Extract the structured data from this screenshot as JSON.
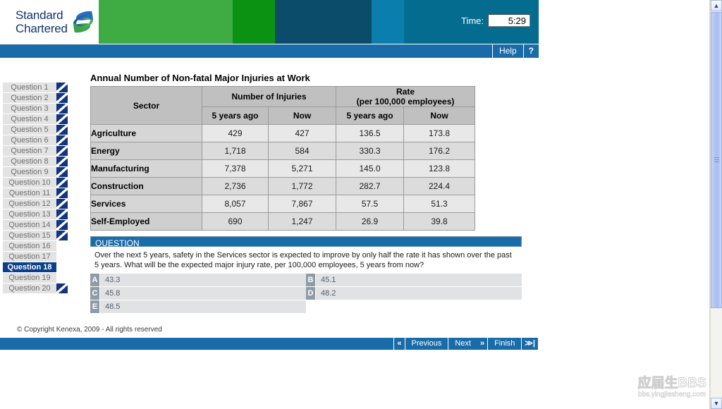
{
  "brand": {
    "line1": "Standard",
    "line2": "Chartered",
    "logo_icon": "standard-chartered-twist-logo"
  },
  "header": {
    "time_label": "Time:",
    "time_value": "5:29",
    "bands": [
      "#3eac43",
      "#0c9212",
      "#0b4c6b",
      "#0a7fae",
      "#046c8f"
    ]
  },
  "navbar": {
    "help_label": "Help",
    "question_mark_label": "?"
  },
  "sidebar": {
    "items": [
      {
        "label": "Question 1",
        "marked": true,
        "selected": false
      },
      {
        "label": "Question 2",
        "marked": true,
        "selected": false
      },
      {
        "label": "Question 3",
        "marked": true,
        "selected": false
      },
      {
        "label": "Question 4",
        "marked": true,
        "selected": false
      },
      {
        "label": "Question 5",
        "marked": true,
        "selected": false
      },
      {
        "label": "Question 6",
        "marked": true,
        "selected": false
      },
      {
        "label": "Question 7",
        "marked": true,
        "selected": false
      },
      {
        "label": "Question 8",
        "marked": true,
        "selected": false
      },
      {
        "label": "Question 9",
        "marked": true,
        "selected": false
      },
      {
        "label": "Question 10",
        "marked": true,
        "selected": false
      },
      {
        "label": "Question 11",
        "marked": true,
        "selected": false
      },
      {
        "label": "Question 12",
        "marked": true,
        "selected": false
      },
      {
        "label": "Question 13",
        "marked": true,
        "selected": false
      },
      {
        "label": "Question 14",
        "marked": true,
        "selected": false
      },
      {
        "label": "Question 15",
        "marked": true,
        "selected": false
      },
      {
        "label": "Question 16",
        "marked": false,
        "selected": false
      },
      {
        "label": "Question 17",
        "marked": false,
        "selected": false
      },
      {
        "label": "Question 18",
        "marked": false,
        "selected": true
      },
      {
        "label": "Question 19",
        "marked": false,
        "selected": false
      },
      {
        "label": "Question 20",
        "marked": true,
        "selected": false
      }
    ]
  },
  "main": {
    "table_title": "Annual Number of Non-fatal Major Injuries at Work",
    "table": {
      "group_headers": [
        {
          "label": "Sector"
        },
        {
          "label": "Number of Injuries"
        },
        {
          "label": "Rate\n(per 100,000 employees)",
          "line1": "Rate",
          "line2": "(per 100,000 employees)"
        }
      ],
      "sub_headers": [
        "5 years ago",
        "Now",
        "5 years ago",
        "Now"
      ],
      "rows": [
        {
          "sector": "Agriculture",
          "injuries_5y": "429",
          "injuries_now": "427",
          "rate_5y": "136.5",
          "rate_now": "173.8"
        },
        {
          "sector": "Energy",
          "injuries_5y": "1,718",
          "injuries_now": "584",
          "rate_5y": "330.3",
          "rate_now": "176.2"
        },
        {
          "sector": "Manufacturing",
          "injuries_5y": "7,378",
          "injuries_now": "5,271",
          "rate_5y": "145.0",
          "rate_now": "123.8"
        },
        {
          "sector": "Construction",
          "injuries_5y": "2,736",
          "injuries_now": "1,772",
          "rate_5y": "282.7",
          "rate_now": "224.4"
        },
        {
          "sector": "Services",
          "injuries_5y": "8,057",
          "injuries_now": "7,867",
          "rate_5y": "57.5",
          "rate_now": "51.3"
        },
        {
          "sector": "Self-Employed",
          "injuries_5y": "690",
          "injuries_now": "1,247",
          "rate_5y": "26.9",
          "rate_now": "39.8"
        }
      ]
    },
    "question": {
      "header": "QUESTION",
      "text": "Over the next 5 years, safety in the Services sector is expected to improve by only half the rate it has shown over the past 5 years. What will be the expected major injury rate, per 100,000 employees, 5 years from now?",
      "options": [
        {
          "letter": "A",
          "text": "43.3"
        },
        {
          "letter": "B",
          "text": "45.1"
        },
        {
          "letter": "C",
          "text": "45.8"
        },
        {
          "letter": "D",
          "text": "48.2"
        },
        {
          "letter": "E",
          "text": "48.5"
        }
      ]
    }
  },
  "chart_data": {
    "type": "table",
    "title": "Annual Number of Non-fatal Major Injuries at Work",
    "categories": [
      "Agriculture",
      "Energy",
      "Manufacturing",
      "Construction",
      "Services",
      "Self-Employed"
    ],
    "series": [
      {
        "name": "Number of Injuries - 5 years ago",
        "values": [
          429,
          1718,
          7378,
          2736,
          8057,
          690
        ]
      },
      {
        "name": "Number of Injuries - Now",
        "values": [
          427,
          584,
          5271,
          1772,
          7867,
          1247
        ]
      },
      {
        "name": "Rate (per 100,000 employees) - 5 years ago",
        "values": [
          136.5,
          330.3,
          145.0,
          282.7,
          57.5,
          26.9
        ]
      },
      {
        "name": "Rate (per 100,000 employees) - Now",
        "values": [
          173.8,
          176.2,
          123.8,
          224.4,
          51.3,
          39.8
        ]
      }
    ],
    "xlabel": "Sector",
    "ylabel": ""
  },
  "footer": {
    "copyright": "© Copyright Kenexa, 2009 - All rights reserved",
    "first_icon": "«",
    "previous_label": "Previous",
    "next_label": "Next",
    "next_icon": "»",
    "finish_label": "Finish",
    "last_icon": "≫|"
  },
  "watermark": {
    "big": "应届生BBS",
    "small": "bbs.yingjiesheng.com"
  },
  "scrollbar": {
    "up_arrow": "▲",
    "down_arrow": "▼"
  }
}
